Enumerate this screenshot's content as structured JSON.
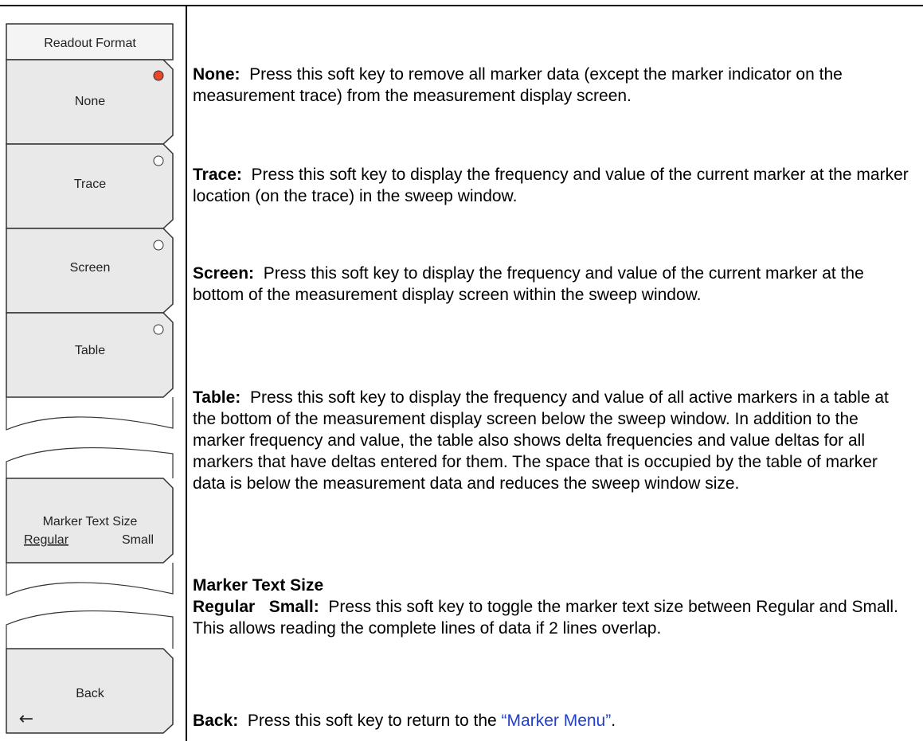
{
  "menu": {
    "title": "Readout Format",
    "keys": [
      {
        "label": "None",
        "selected": true
      },
      {
        "label": "Trace",
        "selected": false
      },
      {
        "label": "Screen",
        "selected": false
      },
      {
        "label": "Table",
        "selected": false
      }
    ],
    "text_size_key": {
      "label": "Marker Text Size",
      "option_regular": "Regular",
      "option_small": "Small"
    },
    "back_key": {
      "label": "Back",
      "arrow": "←"
    }
  },
  "descriptions": {
    "none": {
      "term": "None:",
      "text": "Press this soft key to remove all marker data (except the marker indicator on the measurement trace) from the measurement display screen."
    },
    "trace": {
      "term": "Trace:",
      "text": "Press this soft key to display the frequency and value of the current marker at the marker location (on the trace) in the sweep window."
    },
    "screen": {
      "term": "Screen:",
      "text": "Press this soft key to display the frequency and value of the current marker at the bottom of the measurement display screen within the sweep window."
    },
    "table": {
      "term": "Table:",
      "text": "Press this soft key to display the frequency and value of all active markers in a table at the bottom of the measurement display screen below the sweep window. In addition to the marker frequency and value, the table also shows delta frequencies and value deltas for all markers that have deltas entered for them. The space that is occupied by the table of marker data is below the measurement data and reduces the sweep window size."
    },
    "text_size": {
      "heading": "Marker Text Size",
      "term": "Regular   Small:",
      "text": "Press this soft key to toggle the marker text size between Regular and Small. This allows reading the complete lines of data if 2 lines overlap."
    },
    "back": {
      "term": "Back:",
      "text": "Press this soft key to return to the",
      "link": "“Marker Menu”",
      "end": "."
    }
  },
  "colors": {
    "selected_indicator": "#e8472a",
    "link": "#1f3fcc",
    "key_fill": "#e9e9e9"
  }
}
